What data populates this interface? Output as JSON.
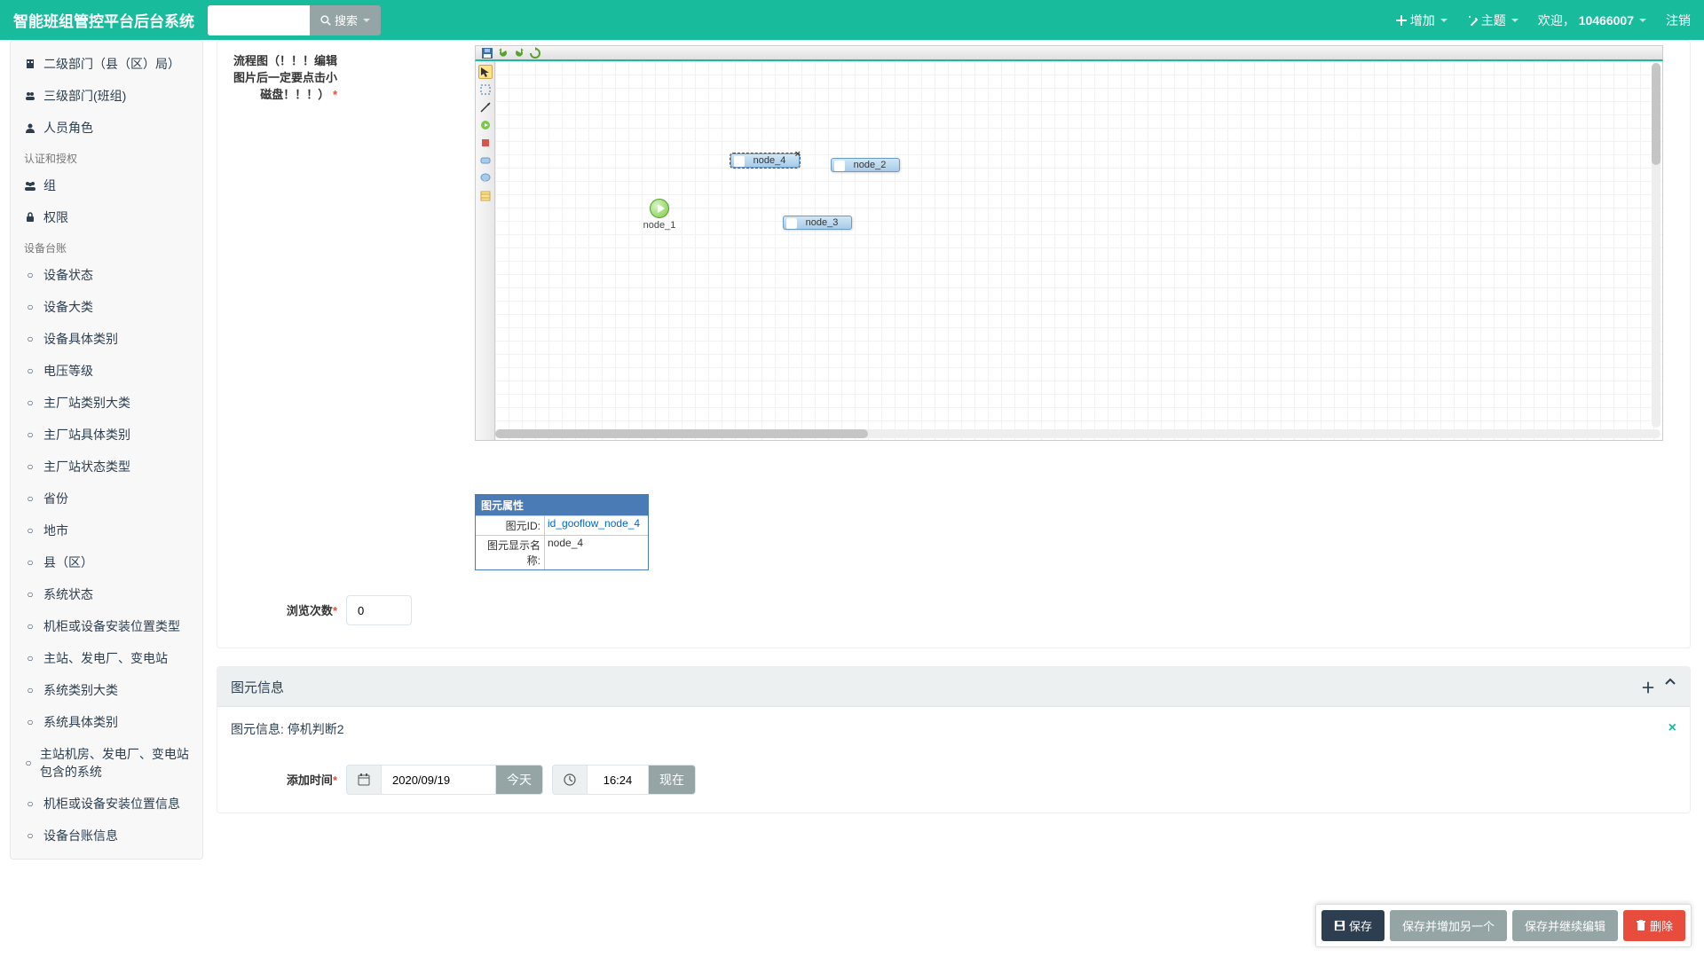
{
  "header": {
    "brand": "智能班组管控平台后台系统",
    "search_btn": "搜索",
    "add": "增加",
    "theme": "主题",
    "welcome_prefix": "欢迎，",
    "username": "10466007",
    "logout": "注销"
  },
  "sidebar": {
    "items1": [
      {
        "label": "二级部门（县（区）局）"
      },
      {
        "label": "三级部门(班组)"
      },
      {
        "label": "人员角色"
      }
    ],
    "section_auth": "认证和授权",
    "items_auth": [
      {
        "label": "组"
      },
      {
        "label": "权限"
      }
    ],
    "section_dev": "设备台账",
    "items_dev": [
      {
        "label": "设备状态"
      },
      {
        "label": "设备大类"
      },
      {
        "label": "设备具体类别"
      },
      {
        "label": "电压等级"
      },
      {
        "label": "主厂站类别大类"
      },
      {
        "label": "主厂站具体类别"
      },
      {
        "label": "主厂站状态类型"
      },
      {
        "label": "省份"
      },
      {
        "label": "地市"
      },
      {
        "label": "县（区）"
      },
      {
        "label": "系统状态"
      },
      {
        "label": "机柜或设备安装位置类型"
      },
      {
        "label": "主站、发电厂、变电站"
      },
      {
        "label": "系统类别大类"
      },
      {
        "label": "系统具体类别"
      },
      {
        "label": "主站机房、发电厂、变电站包含的系统"
      },
      {
        "label": "机柜或设备安装位置信息"
      },
      {
        "label": "设备台账信息"
      }
    ]
  },
  "form": {
    "flow_label": "流程图（！！！编辑图片后一定要点击小磁盘！！！）",
    "views_label": "浏览次数",
    "views_value": "0"
  },
  "nodes": {
    "start": "node_1",
    "n2": "node_2",
    "n3": "node_3",
    "n4": "node_4"
  },
  "props": {
    "header": "图元属性",
    "id_label": "图元ID:",
    "id_value": "id_gooflow_node_4",
    "name_label": "图元显示名称:",
    "name_value": "node_4"
  },
  "sub_panel": {
    "heading": "图元信息",
    "body_title_prefix": "图元信息: ",
    "body_title_value": "停机判断2",
    "add_time_label": "添加时间",
    "date": "2020/09/19",
    "today": "今天",
    "time": "16:24",
    "now": "现在"
  },
  "buttons": {
    "save": "保存",
    "save_add": "保存并增加另一个",
    "save_cont": "保存并继续编辑",
    "delete": "删除"
  }
}
